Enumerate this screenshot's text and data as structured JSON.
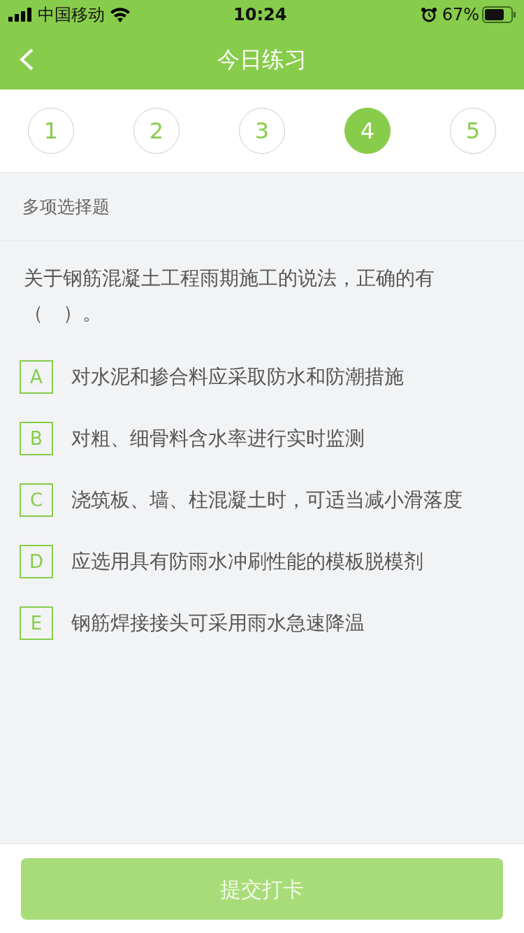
{
  "status_bar": {
    "carrier": "中国移动",
    "time": "10:24",
    "battery": "67%"
  },
  "header": {
    "title": "今日练习"
  },
  "question_numbers": [
    {
      "label": "1",
      "selected": false
    },
    {
      "label": "2",
      "selected": false
    },
    {
      "label": "3",
      "selected": false
    },
    {
      "label": "4",
      "selected": true
    },
    {
      "label": "5",
      "selected": false
    }
  ],
  "question_type": "多项选择题",
  "question": "关于钢筋混凝土工程雨期施工的说法，正确的有（　）。",
  "options": [
    {
      "letter": "A",
      "text": "对水泥和掺合料应采取防水和防潮措施",
      "selected": false
    },
    {
      "letter": "B",
      "text": "对粗、细骨料含水率进行实时监测",
      "selected": false
    },
    {
      "letter": "C",
      "text": "浇筑板、墙、柱混凝土时，可适当减小滑落度",
      "selected": false
    },
    {
      "letter": "D",
      "text": "应选用具有防雨水冲刷性能的模板脱模剂",
      "selected": false
    },
    {
      "letter": "E",
      "text": "钢筋焊接接头可采用雨水急速降温",
      "selected": false
    }
  ],
  "submit": {
    "label": "提交打卡",
    "disabled": true
  }
}
